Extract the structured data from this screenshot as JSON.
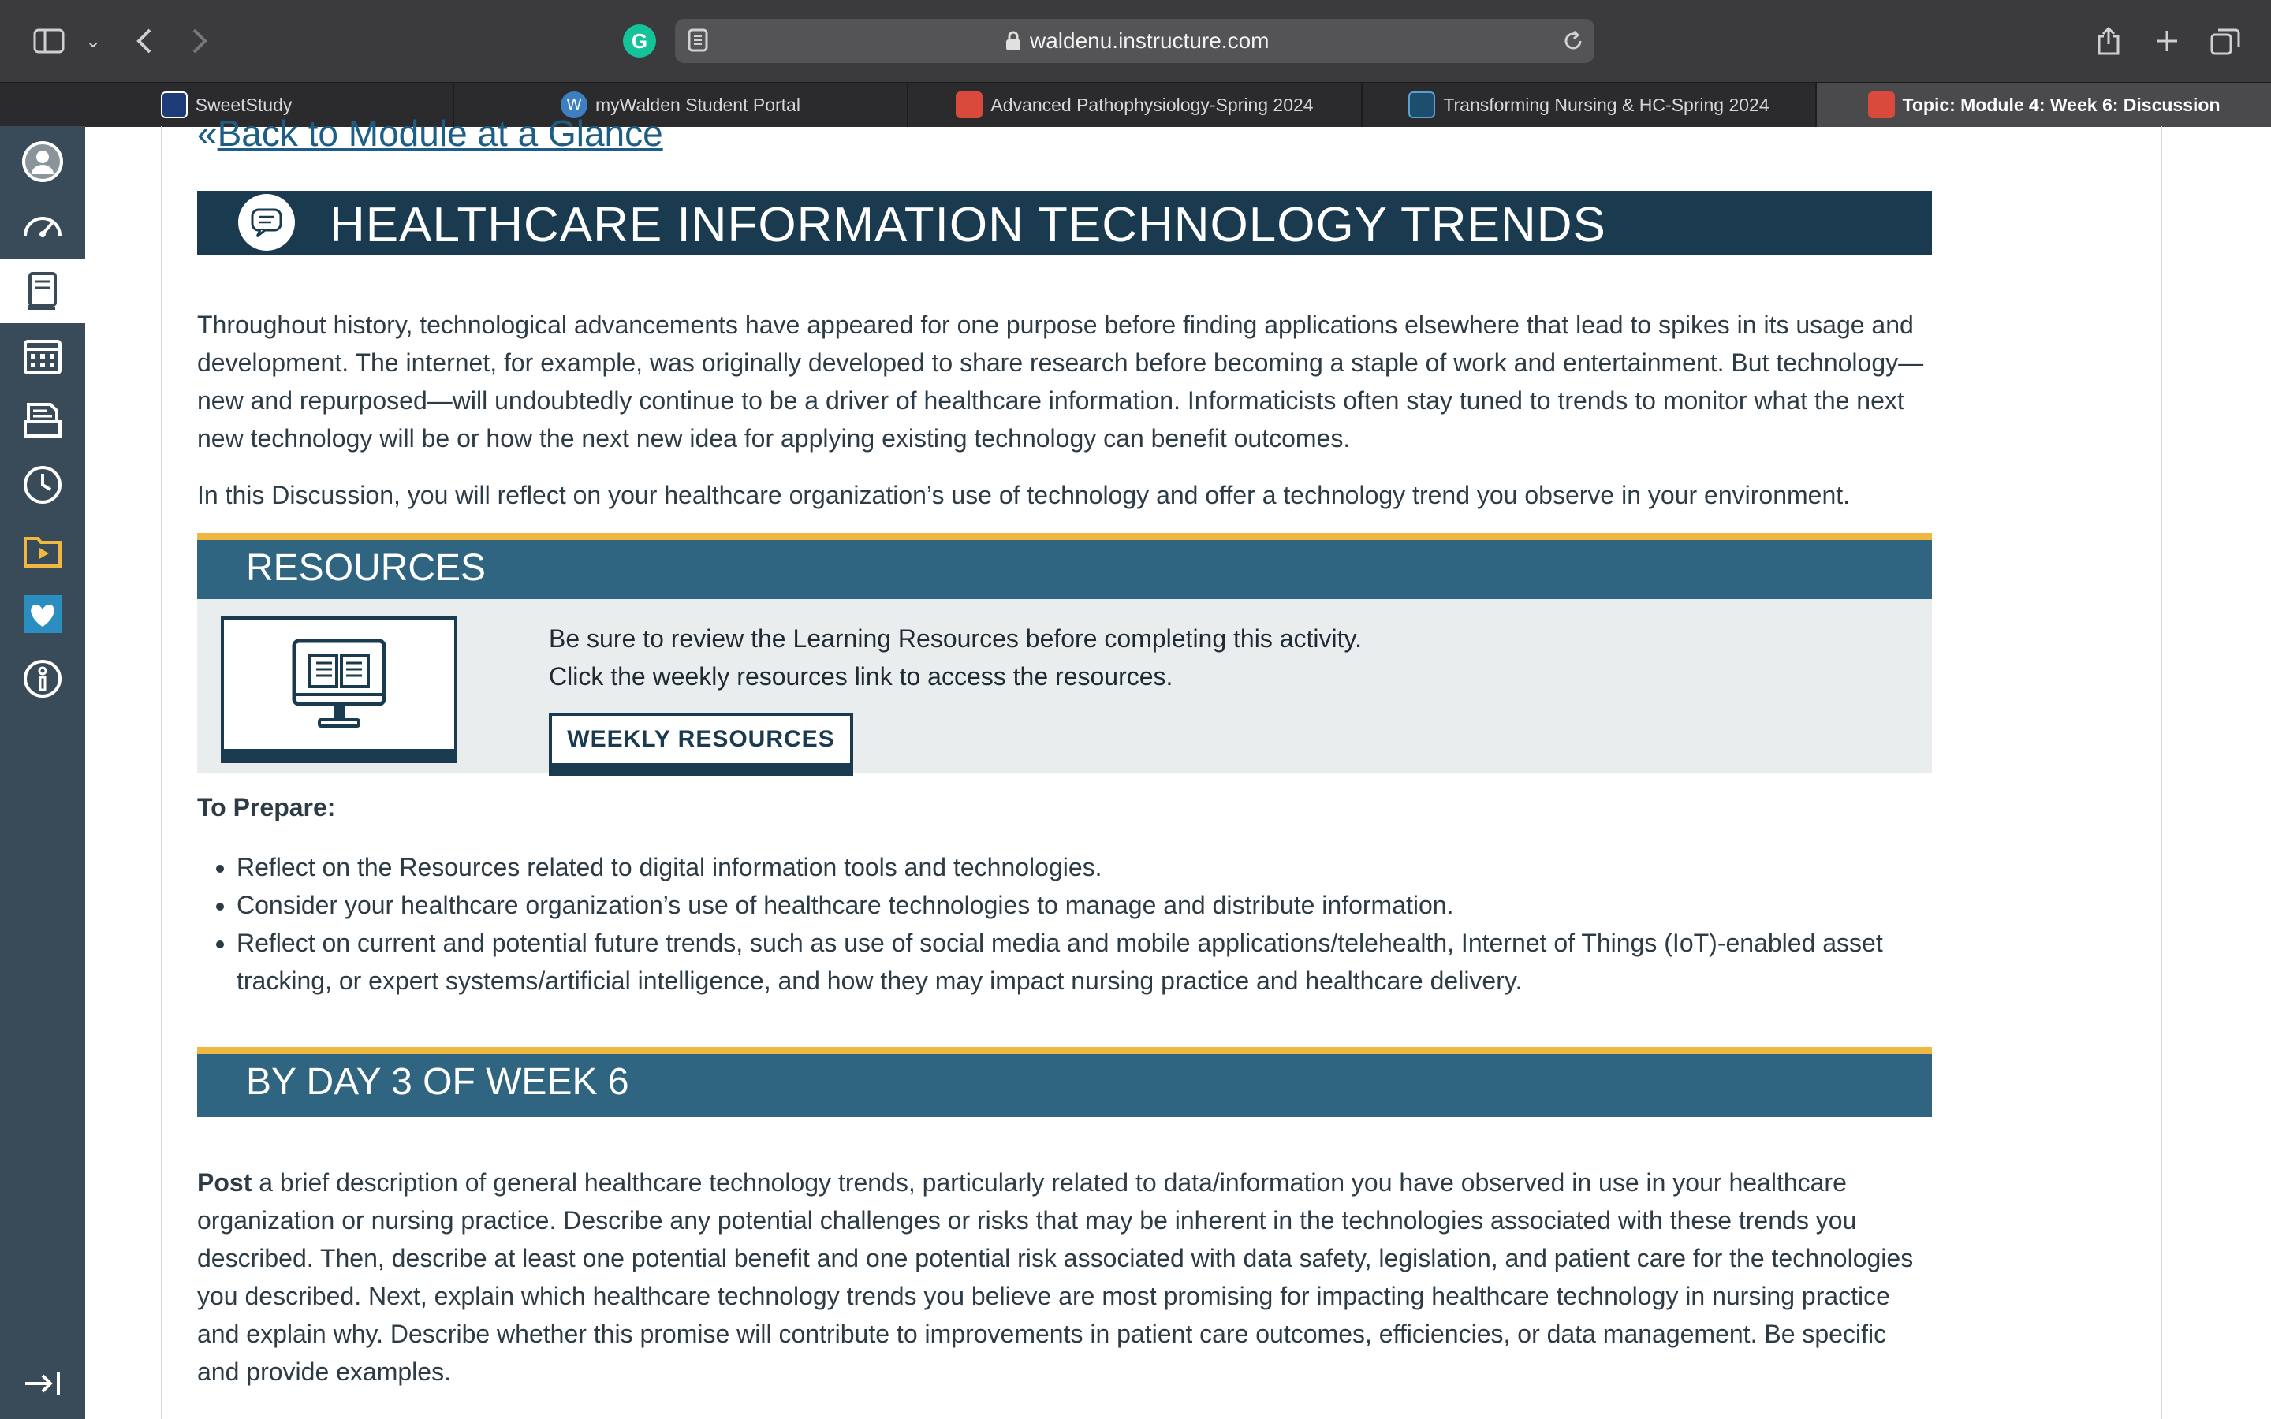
{
  "browser": {
    "url": "waldenu.instructure.com",
    "tabs": [
      {
        "label": "SweetStudy",
        "active": false
      },
      {
        "label": "myWalden Student Portal",
        "active": false
      },
      {
        "label": "Advanced Pathophysiology-Spring 2024",
        "active": false
      },
      {
        "label": "Transforming Nursing & HC-Spring 2024",
        "active": false
      },
      {
        "label": "Topic: Module 4: Week 6: Discussion",
        "active": true
      }
    ]
  },
  "sidenav": {
    "items": [
      "account-icon",
      "dashboard-icon",
      "courses-icon",
      "calendar-icon",
      "inbox-icon",
      "history-icon",
      "studio-icon",
      "commons-icon",
      "help-icon",
      "collapse-icon"
    ],
    "active": "courses-icon"
  },
  "page": {
    "back_link": "Back to Module at a Glance",
    "title": "HEALTHCARE INFORMATION TECHNOLOGY TRENDS",
    "intro_1": "Throughout history, technological advancements have appeared for one purpose before finding applications elsewhere that lead to spikes in its usage and development. The internet, for example, was originally developed to share research before becoming a staple of work and entertainment. But technology—new and repurposed—will undoubtedly continue to be a driver of healthcare information. Informaticists often stay tuned to trends to monitor what the next new technology will be or how the next new idea for applying existing technology can benefit outcomes.",
    "intro_2": "In this Discussion, you will reflect on your healthcare organization’s use of technology and offer a technology trend you observe in your environment.",
    "resources": {
      "heading": "RESOURCES",
      "line1": "Be sure to review the Learning Resources before completing this activity.",
      "line2": "Click the weekly resources link to access the resources.",
      "button": "WEEKLY RESOURCES"
    },
    "prepare": {
      "label": "To Prepare:",
      "items": [
        "Reflect on the Resources related to digital information tools and technologies.",
        "Consider your healthcare organization’s use of healthcare technologies to manage and distribute information.",
        "Reflect on current and potential future trends, such as use of social media and mobile applications/telehealth, Internet of Things (IoT)-enabled asset tracking, or expert systems/artificial intelligence, and how they may impact nursing practice and healthcare delivery."
      ]
    },
    "day3": {
      "heading": "BY DAY 3 OF WEEK 6",
      "post_bold": "Post",
      "post_text": " a brief description of general healthcare technology trends, particularly related to data/information you have observed in use in your healthcare organization or nursing practice. Describe any potential challenges or risks that may be inherent in the technologies associated with these trends you described. Then, describe at least one potential benefit and one potential risk associated with data safety, legislation, and patient care for the technologies you described. Next, explain which healthcare technology trends you believe are most promising for impacting healthcare technology in nursing practice and explain why. Describe whether this promise will contribute to improvements in patient care outcomes, efficiencies, or data management. Be specific and provide examples."
    }
  },
  "colors": {
    "title_banner": "#1a3a4f",
    "section_banner": "#2f6580",
    "accent_gold": "#f0b841",
    "sidenav": "#394b58",
    "link": "#1e5e86"
  }
}
